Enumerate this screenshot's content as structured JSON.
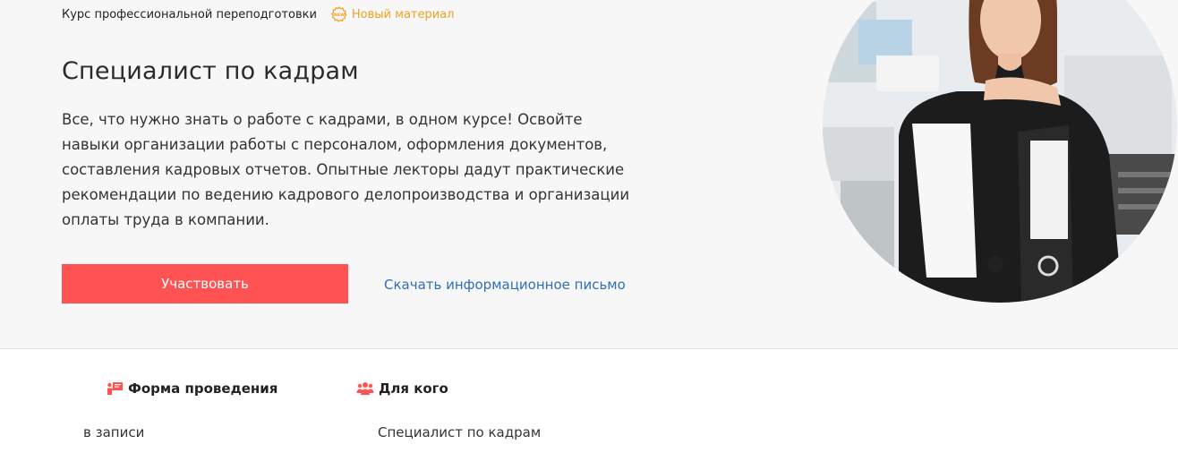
{
  "header": {
    "course_type": "Курс профессиональной переподготовки",
    "new_label": "Новый материал",
    "new_icon_text": "NEW"
  },
  "hero": {
    "title": "Специалист по кадрам",
    "description": "Все, что нужно знать о работе с кадрами, в одном курсе! Освойте навыки организации работы с персоналом, оформления документов, составления кадровых отчетов. Опытные лекторы дадут практические рекомендации по ведению кадрового делопроизводства и организации оплаты труда в компании.",
    "cta_label": "Участвовать",
    "download_link": "Скачать информационное письмо"
  },
  "info": {
    "format": {
      "icon": "presentation-icon",
      "title": "Форма проведения",
      "value": "в записи"
    },
    "audience": {
      "icon": "people-icon",
      "title": "Для кого",
      "value": "Специалист по кадрам"
    }
  },
  "colors": {
    "accent": "#ff5252",
    "link": "#2f6fb5",
    "new_badge": "#f0a020"
  }
}
